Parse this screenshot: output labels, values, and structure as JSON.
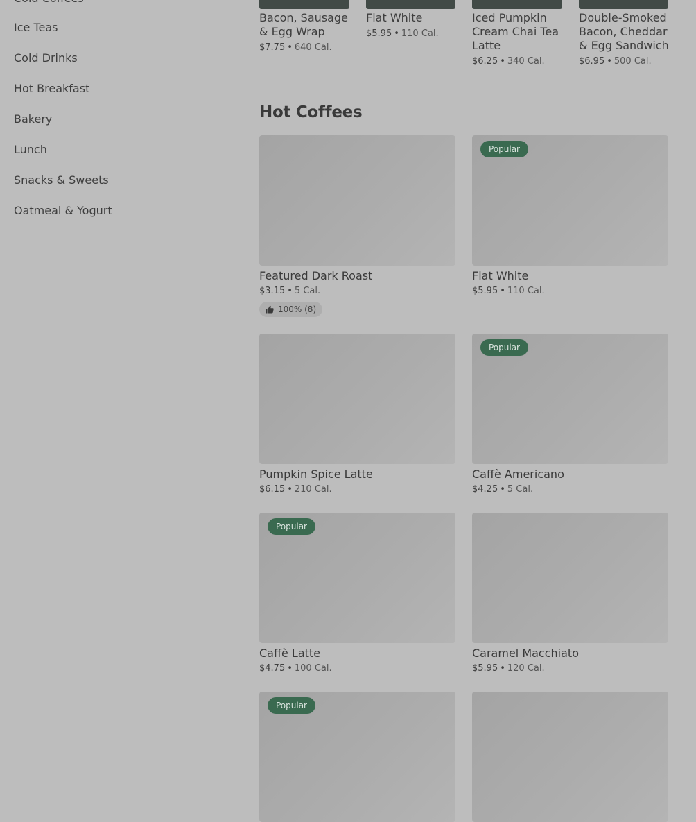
{
  "sidebar": {
    "categories": [
      "Cold Coffees",
      "Ice Teas",
      "Cold Drinks",
      "Hot Breakfast",
      "Bakery",
      "Lunch",
      "Snacks & Sweets",
      "Oatmeal & Yogurt"
    ]
  },
  "featured": [
    {
      "name_line1": "Bacon, Sausage",
      "name_line2": "& Egg Wrap",
      "name_line3": "",
      "price": "$7.75",
      "calories": "640 Cal."
    },
    {
      "name_line1": "Flat White",
      "name_line2": "",
      "name_line3": "",
      "price": "$5.95",
      "calories": "110 Cal."
    },
    {
      "name_line1": "Iced Pumpkin",
      "name_line2": "Cream Chai Tea",
      "name_line3": "Latte",
      "price": "$6.25",
      "calories": "340 Cal."
    },
    {
      "name_line1": "Double-Smoked",
      "name_line2": "Bacon, Cheddar",
      "name_line3": "& Egg Sandwich",
      "price": "$6.95",
      "calories": "500 Cal."
    }
  ],
  "section": {
    "title": "Hot Coffees"
  },
  "separator": "•",
  "badge_label": "Popular",
  "icons": {
    "rating": "thumbs-up-icon"
  },
  "items": [
    {
      "name": "Featured Dark Roast",
      "price": "$3.15",
      "calories": "5 Cal.",
      "popular": false,
      "rating": "100% (8)"
    },
    {
      "name": "Flat White",
      "price": "$5.95",
      "calories": "110 Cal.",
      "popular": true
    },
    {
      "name": "Pumpkin Spice Latte",
      "price": "$6.15",
      "calories": "210 Cal.",
      "popular": false
    },
    {
      "name": "Caffè Americano",
      "price": "$4.25",
      "calories": "5 Cal.",
      "popular": true
    },
    {
      "name": "Caffè Latte",
      "price": "$4.75",
      "calories": "100 Cal.",
      "popular": true
    },
    {
      "name": "Caramel Macchiato",
      "price": "$5.95",
      "calories": "120 Cal.",
      "popular": false
    },
    {
      "name": "",
      "price": "",
      "calories": "",
      "popular": true
    },
    {
      "name": "",
      "price": "",
      "calories": "",
      "popular": false
    }
  ],
  "colors": {
    "background": "#bdbdbd",
    "badge": "#3a6a50",
    "image_placeholder": "#a9a9a9"
  }
}
